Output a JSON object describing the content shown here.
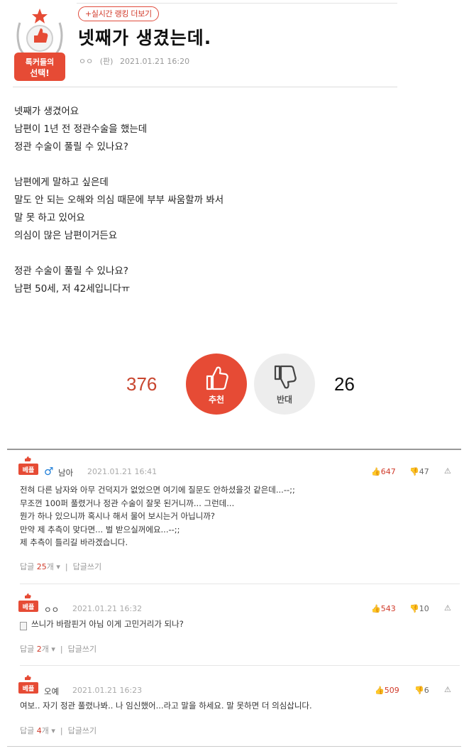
{
  "badge": {
    "line1": "톡커들의",
    "line2": "선택!"
  },
  "post": {
    "ranking_link": "+실시간 랭킹 더보기",
    "title": "넷째가 생겼는데.",
    "author": "ㅇㅇ",
    "category": "(판)",
    "datetime": "2021.01.21 16:20",
    "body": [
      "넷째가 생겼어요",
      "남편이 1년 전 정관수술을 했는데",
      "정관 수술이 풀릴 수 있나요?",
      "",
      "남편에게 말하고 싶은데",
      "말도 안 되는 오해와 의심 때문에 부부 싸움할까 봐서",
      "말 못 하고 있어요",
      "의심이 많은 남편이거든요",
      "",
      "정관 수술이 풀릴 수 있나요?",
      "남편 50세, 저 42세입니다ㅠ"
    ]
  },
  "votes": {
    "up_count": "376",
    "up_label": "추천",
    "down_label": "반대",
    "down_count": "26"
  },
  "comments": [
    {
      "badge": "베플",
      "gender": "♂",
      "author": "남아",
      "datetime": "2021.01.21 16:41",
      "likes": "647",
      "dislikes": "47",
      "lines": [
        "전혀 다른 남자와 아무 건덕지가 없었으면 여기에 질문도 안하셨을것 같은데...--;;",
        "무조껀 100퍼 풀렸거나 정관 수술이 잘못 된거니까... 그런데...",
        "뭔가 하나 있으니까 혹시나 해서 물어 보시는거 아닙니까?",
        "만약 제 추측이 맞다면... 벌 받으실꺼에요...--;;",
        "제 추측이 틀리길 바라겠습니다."
      ],
      "reply_prefix": "답글",
      "reply_count": "25",
      "reply_suffix": "개",
      "write_reply": "답글쓰기"
    },
    {
      "badge": "베플",
      "author": "ㅇㅇ",
      "datetime": "2021.01.21 16:32",
      "likes": "543",
      "dislikes": "10",
      "lines": [
        "쓰니가 바람핀거 아님 이게 고민거리가 되나?"
      ],
      "reply_prefix": "답글",
      "reply_count": "2",
      "reply_suffix": "개",
      "write_reply": "답글쓰기"
    },
    {
      "badge": "베플",
      "author": "오예",
      "datetime": "2021.01.21 16:23",
      "likes": "509",
      "dislikes": "6",
      "lines": [
        "여보.. 자기 정관 풀렸나봐.. 나 임신했어...라고 말을 하세요. 말 못하면 더 의심삽니다."
      ],
      "reply_prefix": "답글",
      "reply_count": "4",
      "reply_suffix": "개",
      "write_reply": "답글쓰기"
    }
  ],
  "colors": {
    "accent": "#e64b35",
    "gray_button": "#ededed",
    "male": "#1e7ed8"
  },
  "icons": [
    "trophy-badge-icon",
    "thumbs-up-icon",
    "thumbs-down-icon",
    "male-icon",
    "memo-icon",
    "report-icon",
    "chevron-down-icon"
  ]
}
